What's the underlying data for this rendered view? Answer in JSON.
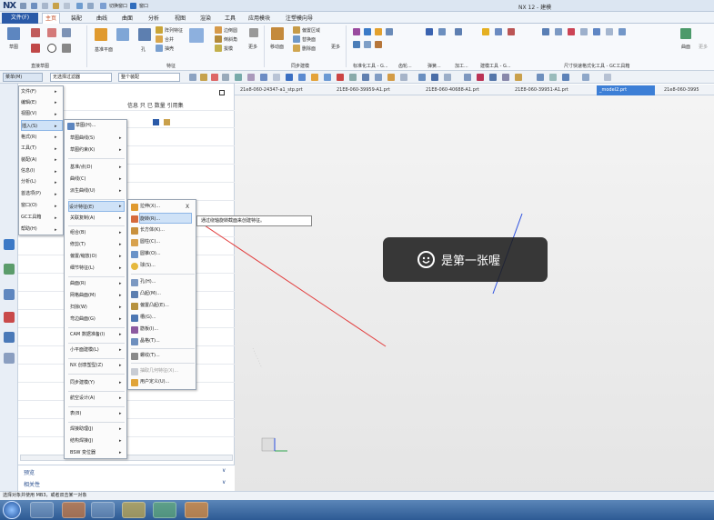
{
  "app": {
    "logo": "NX",
    "title": "NX 12 - 建模"
  },
  "quick_access": {
    "window_label": "切换窗口",
    "window_menu": "窗口"
  },
  "tabs": {
    "file": "文件(F)",
    "items": [
      "主页",
      "装配",
      "曲线",
      "曲面",
      "分析",
      "视图",
      "渲染",
      "工具",
      "应用模块",
      "注塑模向导"
    ]
  },
  "ribbon": {
    "groups": [
      {
        "label": "直接草图"
      },
      {
        "label": "特征"
      },
      {
        "label": "同步建模"
      },
      {
        "label": "标准化工具 - G..."
      },
      {
        "label": "齿轮..."
      },
      {
        "label": "弹簧..."
      },
      {
        "label": "加工..."
      },
      {
        "label": "建模工具 - G..."
      },
      {
        "label": "尺寸快速格式化工具 - GC工具箱"
      }
    ],
    "buttons": {
      "sketch": "草图",
      "array": "阵列特征",
      "combine": "合并",
      "shell": "抽壳",
      "edge_blend": "边倒圆",
      "chamfer": "倒斜角",
      "draft": "拔模",
      "more1": "更多",
      "more2": "更多",
      "more3": "更多",
      "move_face": "移动面",
      "offset": "偏置区域",
      "replace": "替换面",
      "delete_face": "删除面",
      "hole": "孔",
      "datum": "基准平面",
      "surface": "曲面",
      "extrude_t": "拉伸"
    }
  },
  "toolbar2": {
    "menu_btn": "菜单(M)",
    "filter": "无选择过滤器",
    "scope": "整个装配"
  },
  "navigator": {
    "header": "信息  只  已  数量    引用集"
  },
  "doc_tabs": [
    "21e8-060-24347-a1_stp.prt",
    "21E8-060-39959-A1.prt",
    "21E8-060-40688-A1.prt",
    "21E8-060-39951-A1.prt",
    "_model2.prt",
    "21e8-060-3995"
  ],
  "main_menu": [
    "文件(F)",
    "编辑(E)",
    "视图(V)",
    "插入(S)",
    "格式(R)",
    "工具(T)",
    "装配(A)",
    "信息(I)",
    "分析(L)",
    "首选项(P)",
    "窗口(O)",
    "GC工具箱",
    "帮助(H)"
  ],
  "insert_menu": [
    "草图(H)...",
    "草图曲线(S)",
    "草图约束(K)",
    "基准/点(D)",
    "曲线(C)",
    "派生曲线(U)",
    "设计特征(E)",
    "关联复制(A)",
    "组合(B)",
    "修剪(T)",
    "偏置/缩放(O)",
    "细节特征(L)",
    "曲面(R)",
    "网格曲面(M)",
    "扫掠(W)",
    "弯边曲面(G)",
    "CAM 数据准备(I)",
    "小平面建模(L)",
    "NX 创意塑型(Z)",
    "同步建模(Y)",
    "航空设计(A)",
    "表(B)",
    "焊接助理(J)",
    "结构焊接(J)",
    "BSW 变位器"
  ],
  "design_menu": [
    "拉伸(X)...",
    "旋转(R)...",
    "长方体(K)...",
    "圆柱(C)...",
    "圆锥(O)...",
    "球(S)...",
    "孔(H)...",
    "凸起(M)...",
    "偏置凸起(E)...",
    "槽(G)...",
    "筋板(I)...",
    "晶格(T)...",
    "螺纹(T)...",
    "抽取几何特征(X)...",
    "用户定义(U)..."
  ],
  "tooltip": "通过绕轴旋转截面来创建特征。",
  "toast": "是第一张喔",
  "close_x": "X",
  "side_links": {
    "preview": "预览",
    "related": "相关性"
  },
  "status": "选择对象并使用 MB3，或者双击某一对象",
  "colors": {
    "accent": "#2a5aa8",
    "highlight": "#cfe2f7",
    "red_line": "#e23b3b",
    "blue_axis": "#2b4fe0"
  }
}
